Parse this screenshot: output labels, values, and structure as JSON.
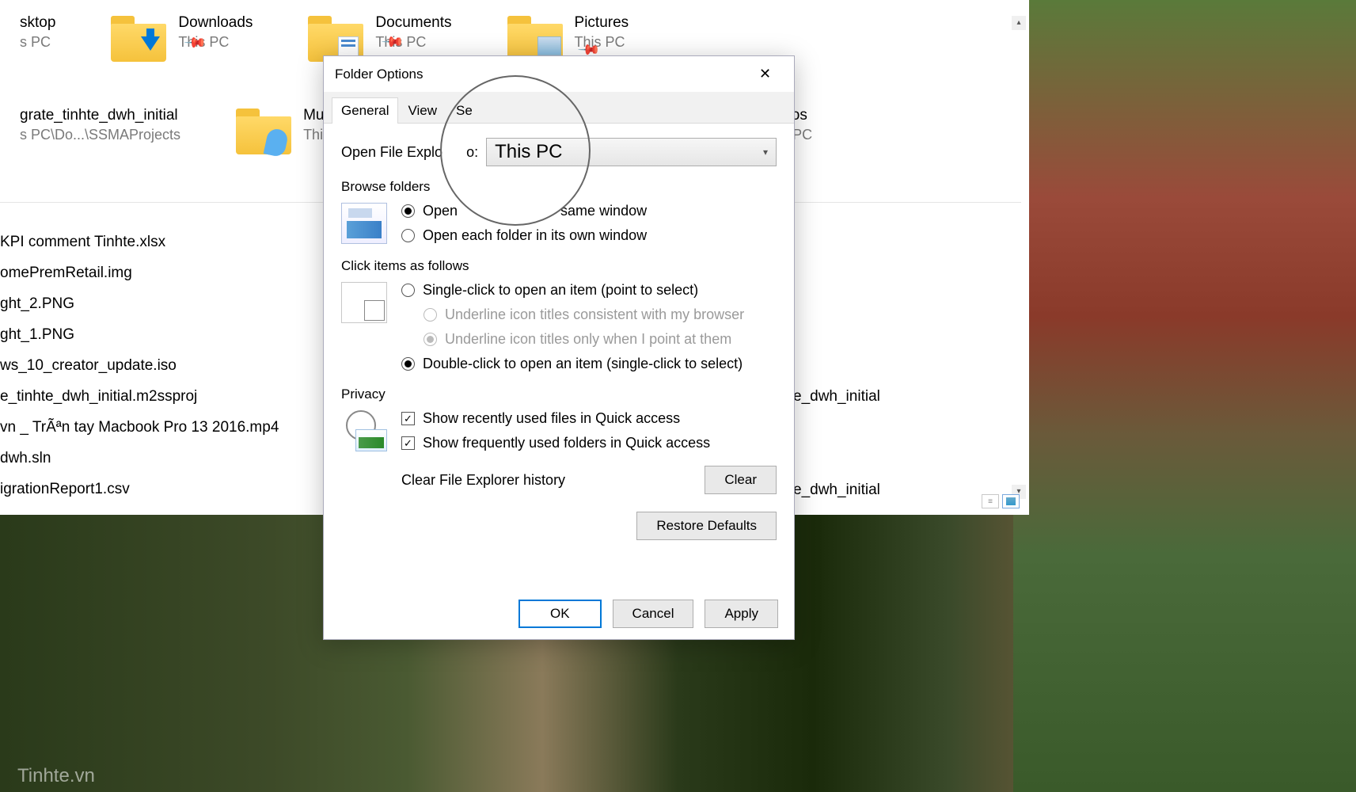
{
  "explorer": {
    "folders_row1": [
      {
        "name": "sktop",
        "loc": "s PC",
        "pinned": false,
        "icon": "none"
      },
      {
        "name": "Downloads",
        "loc": "This PC",
        "pinned": true,
        "icon": "download"
      },
      {
        "name": "Documents",
        "loc": "This PC",
        "pinned": true,
        "icon": "document"
      },
      {
        "name": "Pictures",
        "loc": "This PC",
        "pinned": true,
        "icon": "pictures"
      }
    ],
    "folders_row2": [
      {
        "name": "grate_tinhte_dwh_initial",
        "loc": "s PC\\Do...\\SSMAProjects",
        "pinned": false,
        "icon": "none"
      },
      {
        "name": "Music",
        "loc": "This PC",
        "pinned": false,
        "icon": "music"
      },
      {
        "name": "Videos",
        "loc": "This PC",
        "pinned": false,
        "icon": "none"
      }
    ],
    "files": [
      "KPI comment Tinhte.xlsx",
      "omePremRetail.img",
      "ght_2.PNG",
      "ght_1.PNG",
      "ws_10_creator_update.iso",
      "e_tinhte_dwh_initial.m2ssproj",
      "vn _ TrÃªn tay Macbook Pro 13 2016.mp4",
      "dwh.sln",
      "igrationReport1.csv"
    ],
    "bg_files": [
      "e_dwh_initial",
      "e_dwh_initial"
    ]
  },
  "dialog": {
    "title": "Folder Options",
    "tabs": [
      "General",
      "View",
      "Search"
    ],
    "open_label": "Open File Explorer to:",
    "open_label_clip": "Open File Explo",
    "open_label_suffix": "o:",
    "open_value": "This PC",
    "browse": {
      "label": "Browse folders",
      "opt1": "Open each folder in the same window",
      "opt1_clip_a": "Open",
      "opt1_clip_b": "same window",
      "opt2": "Open each folder in its own window"
    },
    "click": {
      "label": "Click items as follows",
      "opt1": "Single-click to open an item (point to select)",
      "sub1": "Underline icon titles consistent with my browser",
      "sub2": "Underline icon titles only when I point at them",
      "opt2": "Double-click to open an item (single-click to select)"
    },
    "privacy": {
      "label": "Privacy",
      "chk1": "Show recently used files in Quick access",
      "chk2": "Show frequently used folders in Quick access",
      "hist": "Clear File Explorer history",
      "clear": "Clear"
    },
    "restore": "Restore Defaults",
    "ok": "OK",
    "cancel": "Cancel",
    "apply": "Apply"
  },
  "watermark": "Tinhte.vn"
}
